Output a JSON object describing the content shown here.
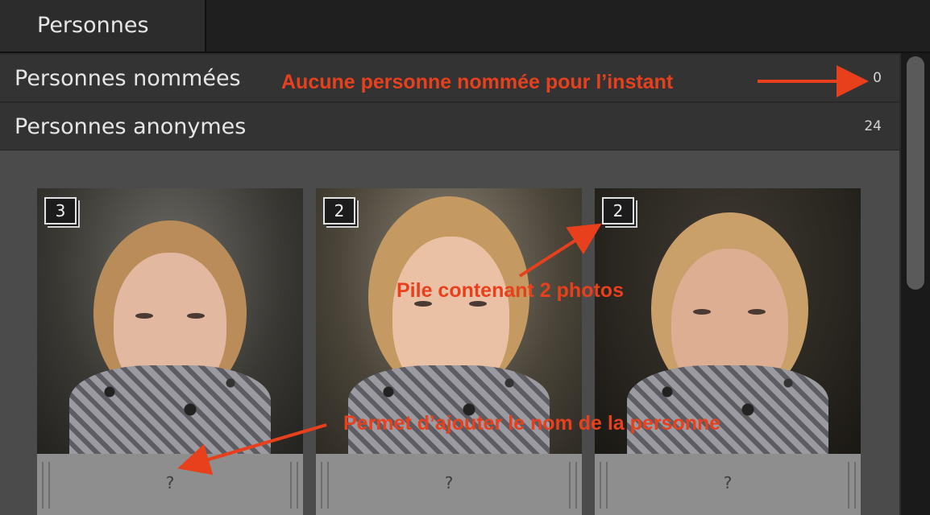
{
  "tab": {
    "label": "Personnes"
  },
  "sections": {
    "named": {
      "label": "Personnes nommées",
      "count": "0"
    },
    "anonymous": {
      "label": "Personnes anonymes",
      "count": "24"
    }
  },
  "cards": [
    {
      "stack_count": "3",
      "name_placeholder": "?"
    },
    {
      "stack_count": "2",
      "name_placeholder": "?"
    },
    {
      "stack_count": "2",
      "name_placeholder": "?"
    }
  ],
  "annotations": {
    "no_named": "Aucune personne nommée pour l’instant",
    "stack": "Pile contenant 2 photos",
    "add_name": "Permet d’ajouter le nom de la personne"
  },
  "colors": {
    "annotation": "#e8401c",
    "panel_bg": "#4b4b4b",
    "header_bg": "#333333"
  }
}
